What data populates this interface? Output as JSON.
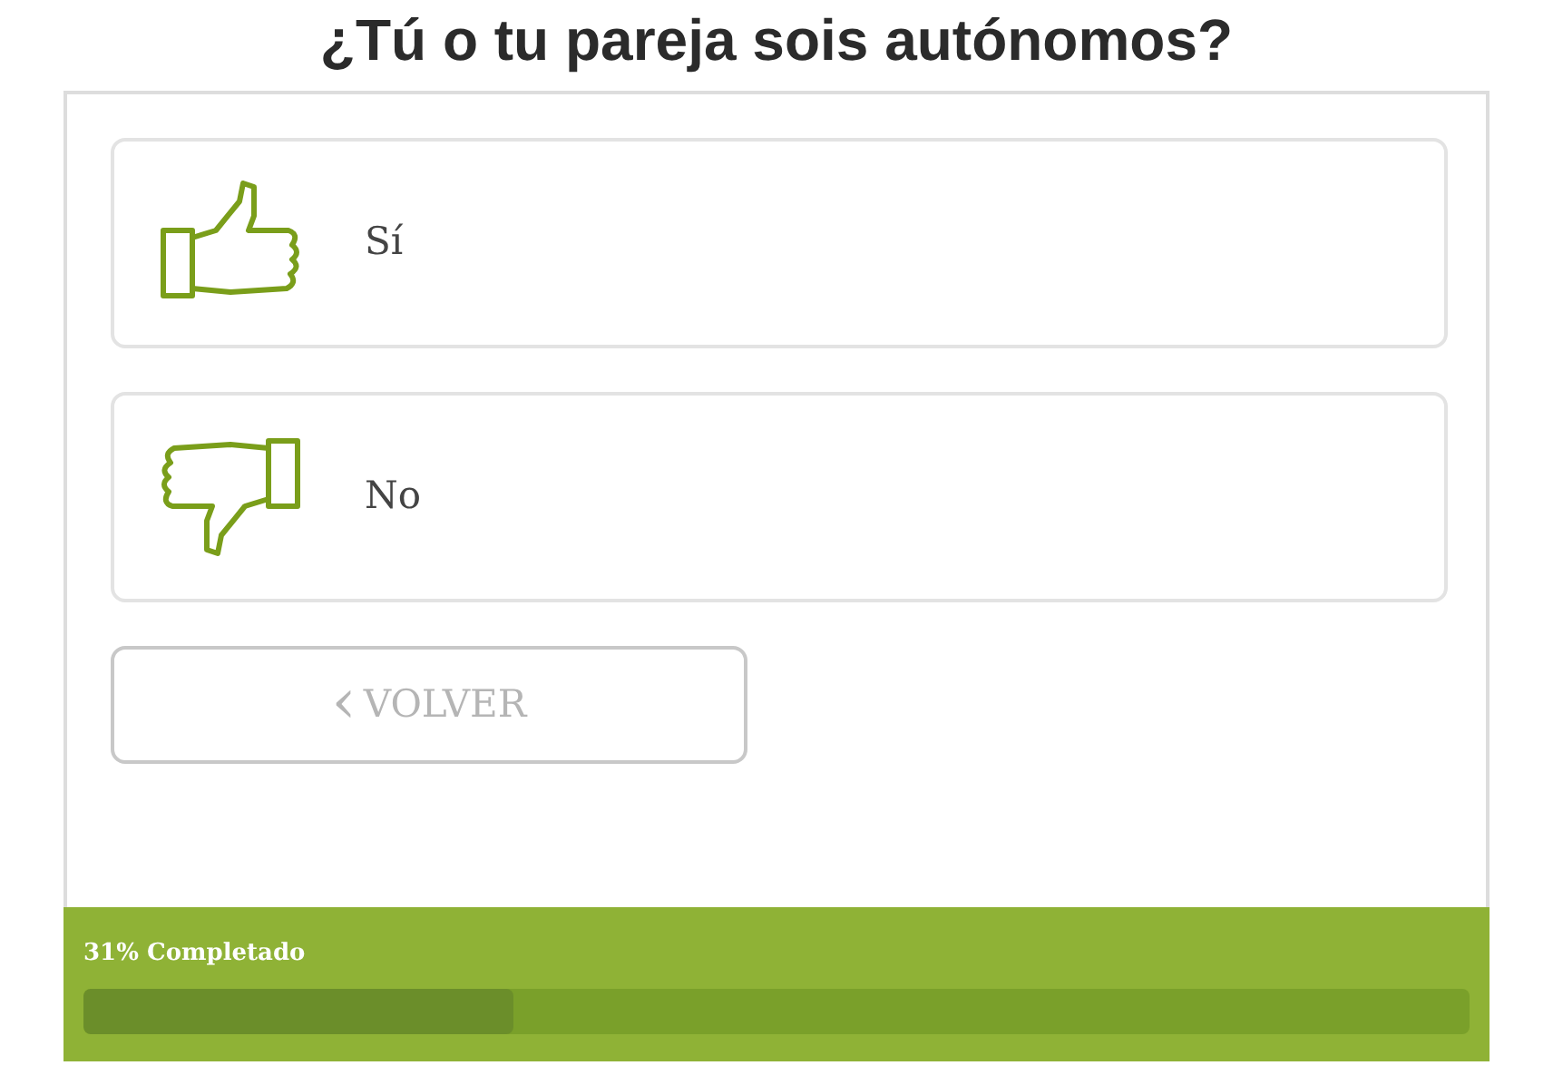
{
  "title": "¿Tú o tu pareja sois autónomos?",
  "options": [
    {
      "label": "Sí",
      "kind": "up",
      "selected": false
    },
    {
      "label": "No",
      "kind": "down",
      "selected": false
    }
  ],
  "back_button": {
    "icon": "‹",
    "label": "VOLVER"
  },
  "progress": {
    "label": "31% Completado",
    "level": 0.31
  }
}
